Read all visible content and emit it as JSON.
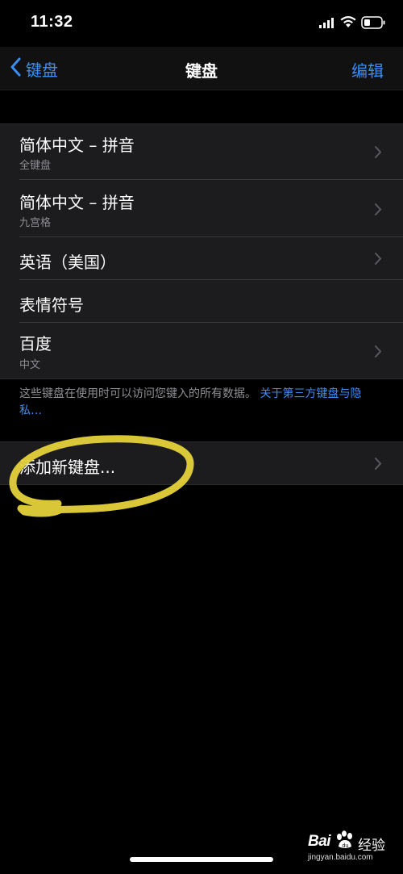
{
  "status_bar": {
    "time": "11:32"
  },
  "nav": {
    "back_label": "键盘",
    "title": "键盘",
    "edit_label": "编辑"
  },
  "keyboards": [
    {
      "title": "简体中文 – 拼音",
      "subtitle": "全键盘"
    },
    {
      "title": "简体中文 – 拼音",
      "subtitle": "九宫格"
    },
    {
      "title": "英语（美国）",
      "subtitle": ""
    },
    {
      "title": "表情符号",
      "subtitle": ""
    },
    {
      "title": "百度",
      "subtitle": "中文"
    }
  ],
  "footer": {
    "note_text": "这些键盘在使用时可以访问您键入的所有数据。",
    "link_text": "关于第三方键盘与隐私…"
  },
  "add_keyboard": {
    "label": "添加新键盘..."
  },
  "annotation": {
    "circle_color": "#e6d23a"
  },
  "watermark": {
    "logo": "Bai",
    "logo_suffix": "经验",
    "url": "jingyan.baidu.com"
  },
  "colors": {
    "accent": "#3b8df3",
    "background": "#000000",
    "cell": "#1c1c1e"
  }
}
